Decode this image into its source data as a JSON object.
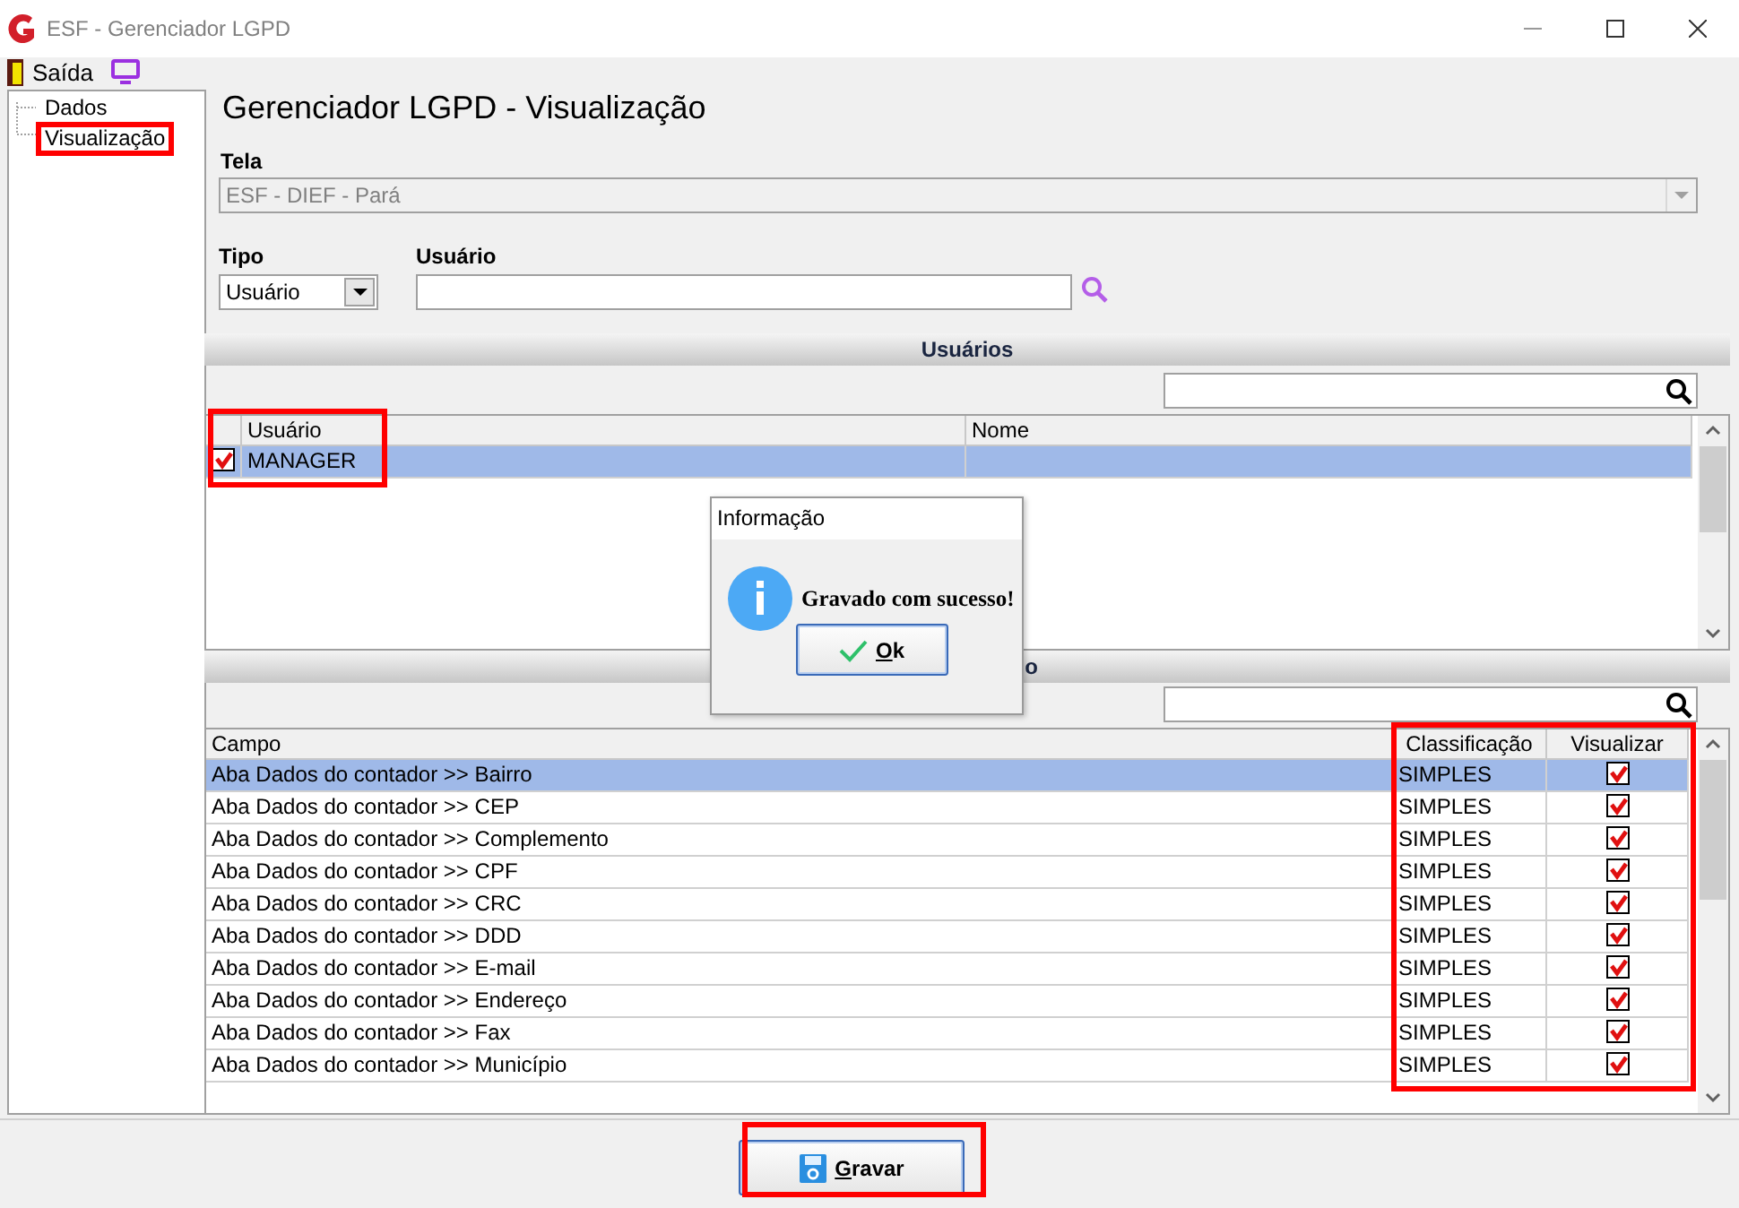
{
  "window": {
    "title": "ESF - Gerenciador LGPD"
  },
  "menu": {
    "exit": "Saída"
  },
  "tree": [
    {
      "label": "Dados",
      "highlighted": false
    },
    {
      "label": "Visualização",
      "highlighted": true
    }
  ],
  "heading": "Gerenciador LGPD - Visualização",
  "tela": {
    "label": "Tela",
    "value": "ESF - DIEF - Pará",
    "disabled": true
  },
  "tipo": {
    "label": "Tipo",
    "value": "Usuário"
  },
  "usuario": {
    "label": "Usuário"
  },
  "users_section": {
    "title": "Usuários"
  },
  "users_grid": {
    "highlighted": true,
    "columns": [
      "Usuário",
      "Nome"
    ],
    "rows": [
      {
        "checked": true,
        "selected": true,
        "cells": [
          "MANAGER"
        ]
      }
    ]
  },
  "fields_section": {
    "title": "o"
  },
  "fields_grid": {
    "columns": [
      {
        "label": "Campo",
        "highlighted": false
      },
      {
        "label": "Classificação",
        "highlighted": true
      },
      {
        "label": "Visualizar",
        "highlighted": true
      }
    ],
    "rows": [
      {
        "campo": "Aba Dados do contador >> Bairro",
        "classificacao": "SIMPLES",
        "visualizar": true,
        "selected": true
      },
      {
        "campo": "Aba Dados do contador >> CEP",
        "classificacao": "SIMPLES",
        "visualizar": true,
        "selected": false
      },
      {
        "campo": "Aba Dados do contador >> Complemento",
        "classificacao": "SIMPLES",
        "visualizar": true,
        "selected": false
      },
      {
        "campo": "Aba Dados do contador >> CPF",
        "classificacao": "SIMPLES",
        "visualizar": true,
        "selected": false
      },
      {
        "campo": "Aba Dados do contador >> CRC",
        "classificacao": "SIMPLES",
        "visualizar": true,
        "selected": false
      },
      {
        "campo": "Aba Dados do contador >> DDD",
        "classificacao": "SIMPLES",
        "visualizar": true,
        "selected": false
      },
      {
        "campo": "Aba Dados do contador >> E-mail",
        "classificacao": "SIMPLES",
        "visualizar": true,
        "selected": false
      },
      {
        "campo": "Aba Dados do contador >> Endereço",
        "classificacao": "SIMPLES",
        "visualizar": true,
        "selected": false
      },
      {
        "campo": "Aba Dados do contador >> Fax",
        "classificacao": "SIMPLES",
        "visualizar": true,
        "selected": false
      },
      {
        "campo": "Aba Dados do contador >> Município",
        "classificacao": "SIMPLES",
        "visualizar": true,
        "selected": false
      }
    ]
  },
  "dialog": {
    "title": "Informação",
    "message": "Gravado com sucesso!",
    "button": "Ok"
  },
  "save_button": {
    "label": "Gravar",
    "highlighted": true
  }
}
